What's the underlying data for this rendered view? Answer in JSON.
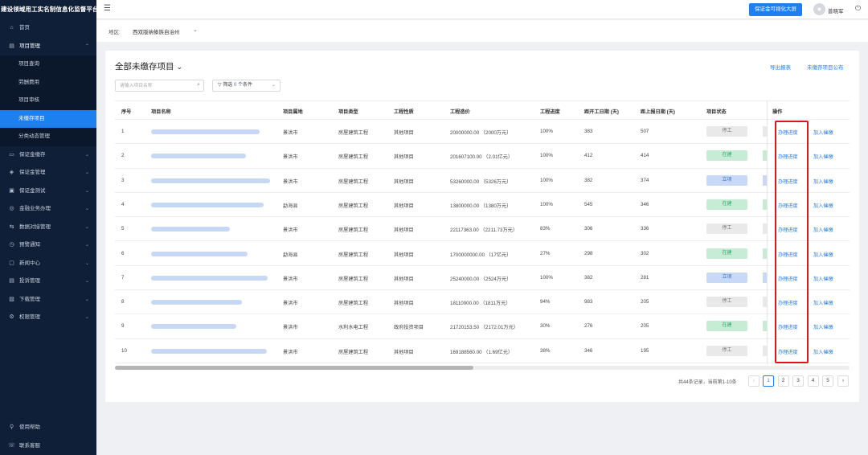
{
  "app": {
    "title": "建设领域用工实名制信息化监督平台"
  },
  "sidebar": {
    "items": [
      {
        "label": "首页",
        "icon": "home-icon",
        "glyph": "⌂",
        "level": 1
      },
      {
        "label": "项目管理",
        "icon": "folder-icon",
        "glyph": "▤",
        "level": 1,
        "expanded": true
      },
      {
        "label": "项目查询",
        "level": 2
      },
      {
        "label": "劳酬费用",
        "level": 2
      },
      {
        "label": "项目审核",
        "level": 2
      },
      {
        "label": "未缴存项目",
        "level": 2,
        "active": true
      },
      {
        "label": "分类动态管理",
        "level": 2
      },
      {
        "label": "保证金缴存",
        "icon": "deposit-icon",
        "glyph": "▭",
        "level": 1
      },
      {
        "label": "保证金管理",
        "icon": "shield-icon",
        "glyph": "◈",
        "level": 1
      },
      {
        "label": "保证金测试",
        "icon": "test-icon",
        "glyph": "▣",
        "level": 1
      },
      {
        "label": "金融业务办理",
        "icon": "finance-icon",
        "glyph": "◎",
        "level": 1
      },
      {
        "label": "数据对接管理",
        "icon": "data-icon",
        "glyph": "⇆",
        "level": 1
      },
      {
        "label": "预警通知",
        "icon": "alert-icon",
        "glyph": "◷",
        "level": 1
      },
      {
        "label": "新闻中心",
        "icon": "news-icon",
        "glyph": "▢",
        "level": 1
      },
      {
        "label": "投诉管理",
        "icon": "complaint-icon",
        "glyph": "▤",
        "level": 1
      },
      {
        "label": "下载管理",
        "icon": "download-icon",
        "glyph": "▧",
        "level": 1
      },
      {
        "label": "权限管理",
        "icon": "permission-icon",
        "glyph": "⚙",
        "level": 1
      }
    ],
    "bottom": [
      {
        "label": "使用帮助",
        "icon": "help-icon",
        "glyph": "⚲"
      },
      {
        "label": "联系客服",
        "icon": "service-icon",
        "glyph": "☏"
      }
    ]
  },
  "topbar": {
    "big_screen_button": "保证金可视化大屏",
    "username": "普晓军"
  },
  "region": {
    "label": "地区:",
    "value": "西双版纳傣族自治州"
  },
  "main": {
    "title": "全部未缴存项目",
    "export_label": "导出报表",
    "publish_label": "未缴存项目公布",
    "search_placeholder": "请输入项目名称",
    "filter": {
      "prefix": "筛选",
      "count": "0",
      "suffix": "个条件"
    },
    "columns": [
      "序号",
      "项目名称",
      "项目属地",
      "项目类型",
      "工程性质",
      "工程造价",
      "工程进度",
      "距开工日期 (天)",
      "距上报日期 (天)",
      "项目状态",
      "操作"
    ],
    "rows": [
      {
        "no": "1",
        "name_width": 135,
        "region": "景洪市",
        "type": "房屋建筑工程",
        "nature": "其他项目",
        "cost": "20000000.00 （2000万元）",
        "progress": "100%",
        "days_start": "383",
        "days_report": "507",
        "status": "停工",
        "status_kind": "stop"
      },
      {
        "no": "2",
        "name_width": 118,
        "region": "景洪市",
        "type": "房屋建筑工程",
        "nature": "其他项目",
        "cost": "201607100.00 （2.01亿元）",
        "progress": "100%",
        "days_start": "412",
        "days_report": "414",
        "status": "在建",
        "status_kind": "run"
      },
      {
        "no": "3",
        "name_width": 148,
        "region": "景洪市",
        "type": "房屋建筑工程",
        "nature": "其他项目",
        "cost": "53260000.00 （5326万元）",
        "progress": "100%",
        "days_start": "382",
        "days_report": "374",
        "status": "立项",
        "status_kind": "set"
      },
      {
        "no": "4",
        "name_width": 140,
        "region": "勐海县",
        "type": "房屋建筑工程",
        "nature": "其他项目",
        "cost": "13800000.00 （1380万元）",
        "progress": "100%",
        "days_start": "545",
        "days_report": "346",
        "status": "在建",
        "status_kind": "run"
      },
      {
        "no": "5",
        "name_width": 98,
        "region": "景洪市",
        "type": "房屋建筑工程",
        "nature": "其他项目",
        "cost": "22117363.00 （2211.73万元）",
        "progress": "83%",
        "days_start": "306",
        "days_report": "336",
        "status": "停工",
        "status_kind": "stop"
      },
      {
        "no": "6",
        "name_width": 120,
        "region": "勐海县",
        "type": "房屋建筑工程",
        "nature": "其他项目",
        "cost": "1700000000.00 （17亿元）",
        "progress": "27%",
        "days_start": "298",
        "days_report": "302",
        "status": "在建",
        "status_kind": "run"
      },
      {
        "no": "7",
        "name_width": 145,
        "region": "景洪市",
        "type": "房屋建筑工程",
        "nature": "其他项目",
        "cost": "25240000.00 （2524万元）",
        "progress": "100%",
        "days_start": "382",
        "days_report": "281",
        "status": "立项",
        "status_kind": "set"
      },
      {
        "no": "8",
        "name_width": 113,
        "region": "景洪市",
        "type": "房屋建筑工程",
        "nature": "其他项目",
        "cost": "18110000.00 （1811万元）",
        "progress": "94%",
        "days_start": "983",
        "days_report": "205",
        "status": "停工",
        "status_kind": "stop"
      },
      {
        "no": "9",
        "name_width": 106,
        "region": "景洪市",
        "type": "水利水电工程",
        "nature": "政府投资项目",
        "cost": "21720153.50 （2172.01万元）",
        "progress": "30%",
        "days_start": "276",
        "days_report": "205",
        "status": "在建",
        "status_kind": "run"
      },
      {
        "no": "10",
        "name_width": 144,
        "region": "景洪市",
        "type": "房屋建筑工程",
        "nature": "其他项目",
        "cost": "169188560.00 （1.69亿元）",
        "progress": "38%",
        "days_start": "346",
        "days_report": "195",
        "status": "停工",
        "status_kind": "stop"
      }
    ],
    "action_progress": "办理进度",
    "action_blacklist": "加入催缴"
  },
  "pagination": {
    "summary": "共44条记录，当前第1-10条",
    "prev": "‹",
    "next": "›",
    "pages": [
      "1",
      "2",
      "3",
      "4",
      "5"
    ],
    "current": "1"
  },
  "colors": {
    "accent": "#1e7fef",
    "sidebar_bg": "#0f1f38",
    "highlight": "#e0151a"
  }
}
